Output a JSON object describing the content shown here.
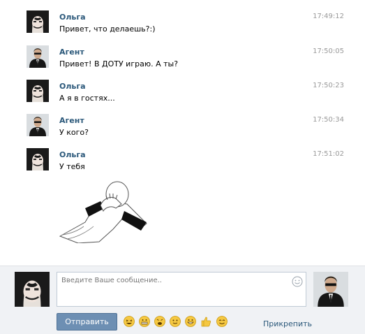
{
  "messages": [
    {
      "author": "Ольга",
      "text": "Привет, что делаешь?:)",
      "time": "17:49:12",
      "avatar_icon": "girl-avatar-icon"
    },
    {
      "author": "Агент",
      "text": "Привет! В ДОТУ играю. А ты?",
      "time": "17:50:05",
      "avatar_icon": "agent-avatar-icon"
    },
    {
      "author": "Ольга",
      "text": "А я в гостях...",
      "time": "17:50:23",
      "avatar_icon": "girl-avatar-icon"
    },
    {
      "author": "Агент",
      "text": "У кого?",
      "time": "17:50:34",
      "avatar_icon": "agent-avatar-icon"
    },
    {
      "author": "Ольга",
      "text": "У тебя",
      "time": "17:51:02",
      "avatar_icon": "girl-avatar-icon"
    }
  ],
  "sticker": {
    "icon": "facepalm-icon"
  },
  "composer": {
    "placeholder": "Введите Ваше сообщение..",
    "send_label": "Отправить",
    "attach_label": "Прикрепить",
    "emojis": [
      "laughing-emoji-icon",
      "grimace-emoji-icon",
      "tired-emoji-icon",
      "smile-emoji-icon",
      "grin-emoji-icon",
      "thumbs-up-icon",
      "smiling-emoji-icon"
    ]
  },
  "colors": {
    "author": "#2b587a",
    "time": "#999999",
    "composer_bg": "#f0f2f5",
    "send_button": "#6d8fb3",
    "emoji_yellow": "#f5c842"
  }
}
